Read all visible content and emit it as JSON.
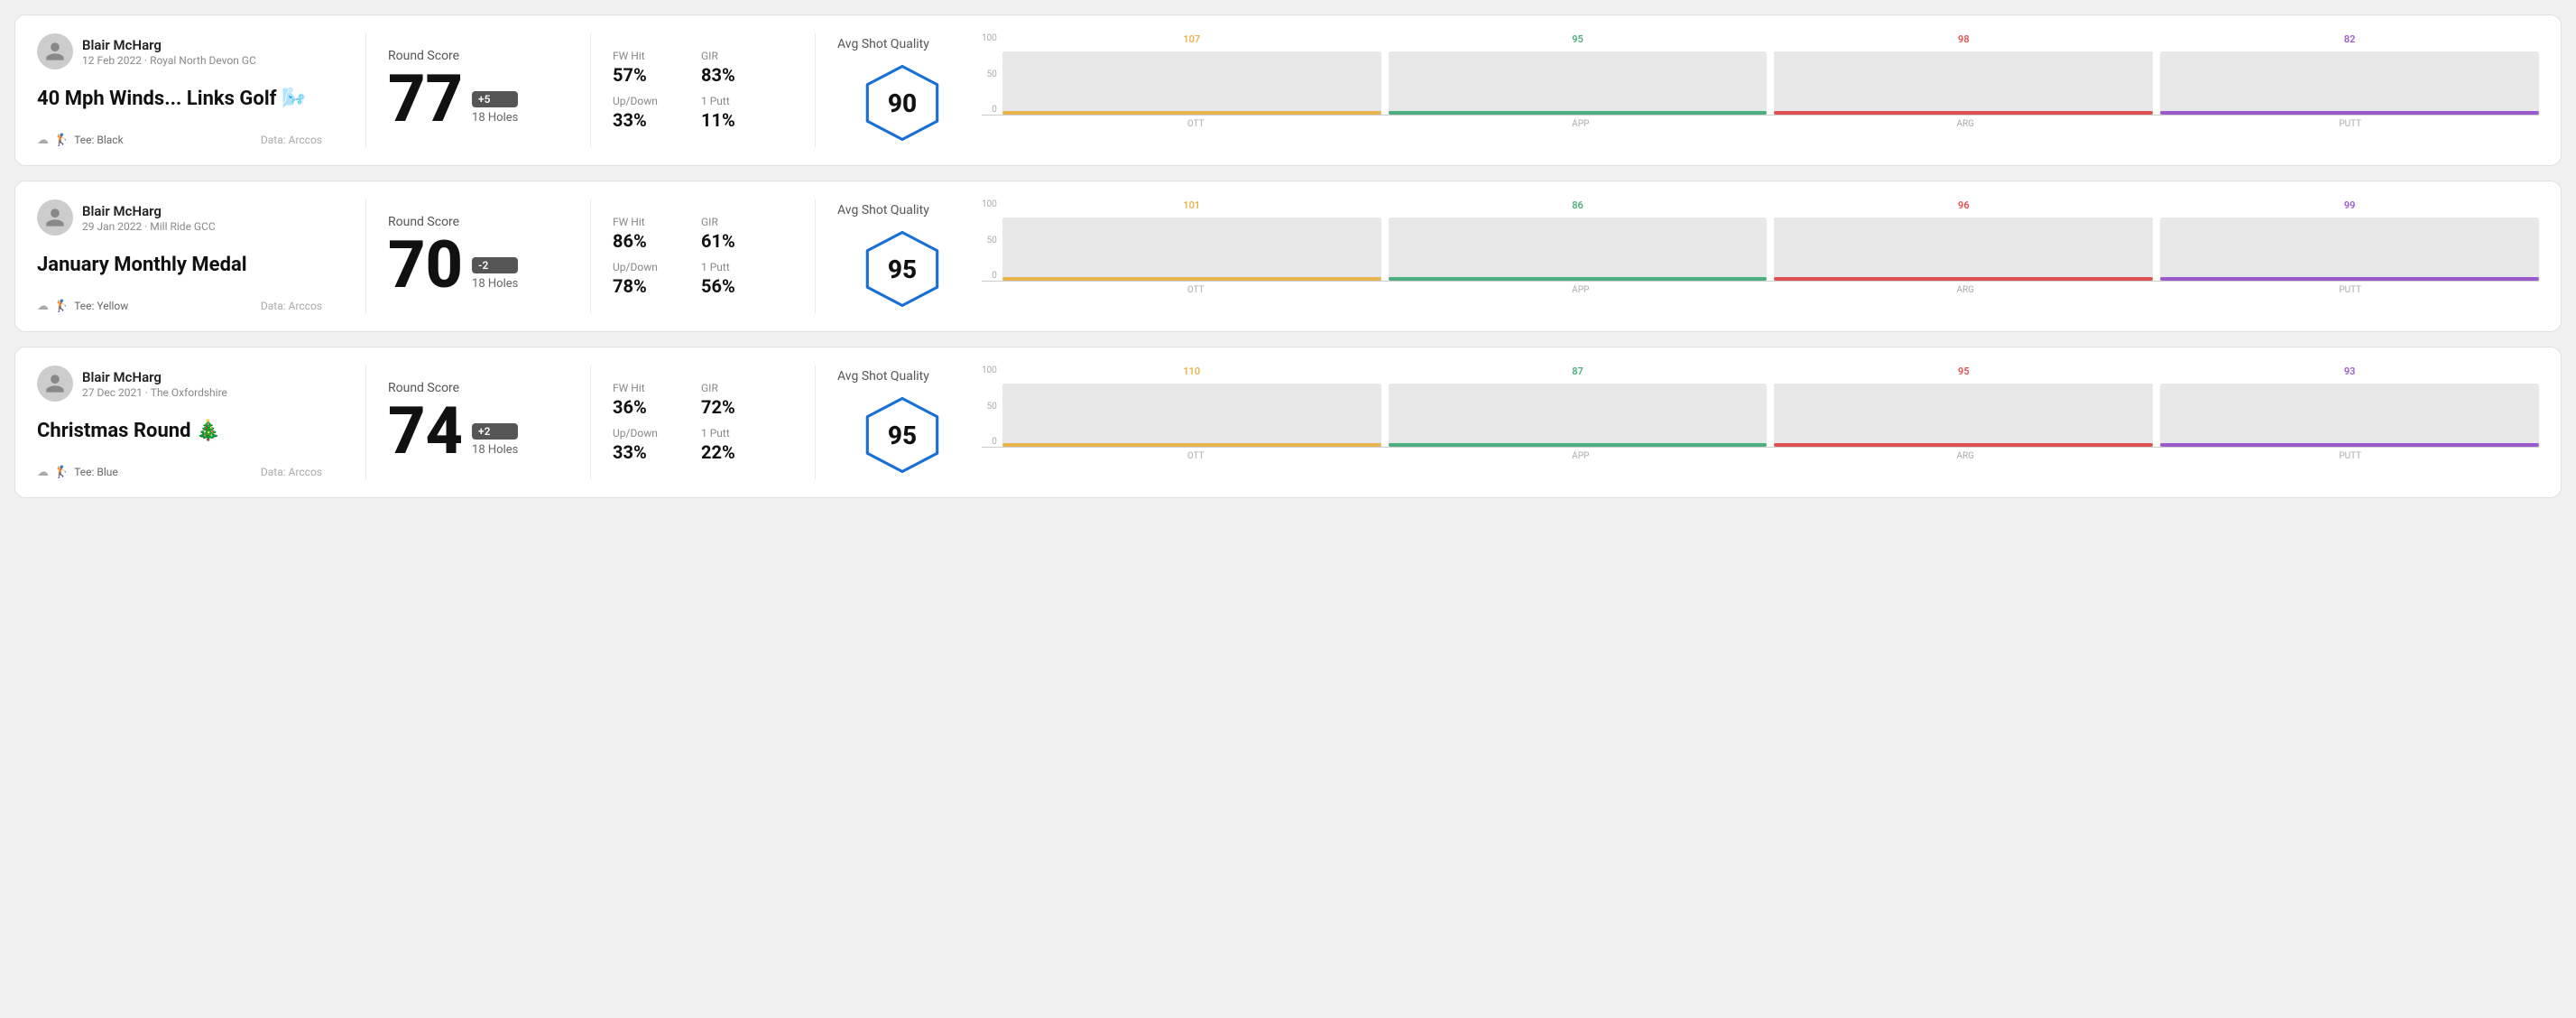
{
  "rounds": [
    {
      "id": "round-1",
      "user": {
        "name": "Blair McHarg",
        "date_course": "12 Feb 2022 · Royal North Devon GC"
      },
      "title": "40 Mph Winds... Links Golf 🌬️",
      "tee": "Black",
      "data_source": "Data: Arccos",
      "score": {
        "label": "Round Score",
        "number": "77",
        "badge": "+5",
        "holes": "18 Holes"
      },
      "stats": [
        {
          "label": "FW Hit",
          "value": "57%"
        },
        {
          "label": "GIR",
          "value": "83%"
        },
        {
          "label": "Up/Down",
          "value": "33%"
        },
        {
          "label": "1 Putt",
          "value": "11%"
        }
      ],
      "quality": {
        "label": "Avg Shot Quality",
        "score": "90"
      },
      "chart": {
        "bars": [
          {
            "label": "OTT",
            "value": 107,
            "color": "#e8b44e",
            "max": 120
          },
          {
            "label": "APP",
            "value": 95,
            "color": "#4caf7d",
            "max": 120
          },
          {
            "label": "ARG",
            "value": 98,
            "color": "#e05050",
            "max": 120
          },
          {
            "label": "PUTT",
            "value": 82,
            "color": "#9c59cc",
            "max": 120
          }
        ],
        "y_labels": [
          "100",
          "50",
          "0"
        ]
      }
    },
    {
      "id": "round-2",
      "user": {
        "name": "Blair McHarg",
        "date_course": "29 Jan 2022 · Mill Ride GCC"
      },
      "title": "January Monthly Medal",
      "tee": "Yellow",
      "data_source": "Data: Arccos",
      "score": {
        "label": "Round Score",
        "number": "70",
        "badge": "-2",
        "holes": "18 Holes"
      },
      "stats": [
        {
          "label": "FW Hit",
          "value": "86%"
        },
        {
          "label": "GIR",
          "value": "61%"
        },
        {
          "label": "Up/Down",
          "value": "78%"
        },
        {
          "label": "1 Putt",
          "value": "56%"
        }
      ],
      "quality": {
        "label": "Avg Shot Quality",
        "score": "95"
      },
      "chart": {
        "bars": [
          {
            "label": "OTT",
            "value": 101,
            "color": "#e8b44e",
            "max": 120
          },
          {
            "label": "APP",
            "value": 86,
            "color": "#4caf7d",
            "max": 120
          },
          {
            "label": "ARG",
            "value": 96,
            "color": "#e05050",
            "max": 120
          },
          {
            "label": "PUTT",
            "value": 99,
            "color": "#9c59cc",
            "max": 120
          }
        ],
        "y_labels": [
          "100",
          "50",
          "0"
        ]
      }
    },
    {
      "id": "round-3",
      "user": {
        "name": "Blair McHarg",
        "date_course": "27 Dec 2021 · The Oxfordshire"
      },
      "title": "Christmas Round 🎄",
      "tee": "Blue",
      "data_source": "Data: Arccos",
      "score": {
        "label": "Round Score",
        "number": "74",
        "badge": "+2",
        "holes": "18 Holes"
      },
      "stats": [
        {
          "label": "FW Hit",
          "value": "36%"
        },
        {
          "label": "GIR",
          "value": "72%"
        },
        {
          "label": "Up/Down",
          "value": "33%"
        },
        {
          "label": "1 Putt",
          "value": "22%"
        }
      ],
      "quality": {
        "label": "Avg Shot Quality",
        "score": "95"
      },
      "chart": {
        "bars": [
          {
            "label": "OTT",
            "value": 110,
            "color": "#e8b44e",
            "max": 120
          },
          {
            "label": "APP",
            "value": 87,
            "color": "#4caf7d",
            "max": 120
          },
          {
            "label": "ARG",
            "value": 95,
            "color": "#e05050",
            "max": 120
          },
          {
            "label": "PUTT",
            "value": 93,
            "color": "#9c59cc",
            "max": 120
          }
        ],
        "y_labels": [
          "100",
          "50",
          "0"
        ]
      }
    }
  ]
}
